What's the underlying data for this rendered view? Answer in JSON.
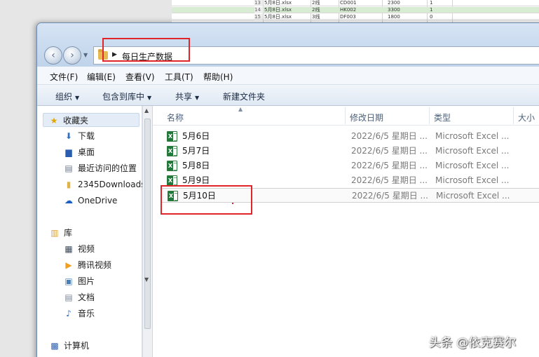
{
  "background_sheet": {
    "rows": [
      {
        "num": "13",
        "file": "5月8日.xlsx",
        "line": "2线",
        "code": "CD001",
        "qty": "2300",
        "flag": "1"
      },
      {
        "num": "14",
        "file": "5月8日.xlsx",
        "line": "2线",
        "code": "HK002",
        "qty": "3300",
        "flag": "1"
      },
      {
        "num": "15",
        "file": "5月8日.xlsx",
        "line": "3线",
        "code": "DF003",
        "qty": "1800",
        "flag": "0"
      }
    ]
  },
  "address_bar": {
    "path": "每日生产数据"
  },
  "menu": [
    "文件(F)",
    "编辑(E)",
    "查看(V)",
    "工具(T)",
    "帮助(H)"
  ],
  "toolbar": {
    "organize": "组织",
    "include_library": "包含到库中",
    "share": "共享",
    "new_folder": "新建文件夹"
  },
  "nav_pane": {
    "favorites": {
      "label": "收藏夹",
      "items": [
        "下载",
        "桌面",
        "最近访问的位置",
        "2345Downloads",
        "OneDrive"
      ]
    },
    "libraries": {
      "label": "库",
      "items": [
        "视频",
        "腾讯视频",
        "图片",
        "文档",
        "音乐"
      ]
    },
    "computer": {
      "label": "计算机"
    }
  },
  "columns": {
    "name": "名称",
    "modified": "修改日期",
    "type": "类型",
    "size": "大小"
  },
  "files": [
    {
      "name": "5月6日",
      "modified": "2022/6/5 星期日 ...",
      "type": "Microsoft Excel ..."
    },
    {
      "name": "5月7日",
      "modified": "2022/6/5 星期日 ...",
      "type": "Microsoft Excel ..."
    },
    {
      "name": "5月8日",
      "modified": "2022/6/5 星期日 ...",
      "type": "Microsoft Excel ..."
    },
    {
      "name": "5月9日",
      "modified": "2022/6/5 星期日 ...",
      "type": "Microsoft Excel ..."
    },
    {
      "name": "5月10日",
      "modified": "2022/6/5 星期日 ...",
      "type": "Microsoft Excel ..."
    }
  ],
  "watermark": "头条 @依克赛尔",
  "colors": {
    "highlight_box": "#e0252a",
    "excel_green": "#1f7a3a",
    "window_frame": "#c7d9ee"
  }
}
